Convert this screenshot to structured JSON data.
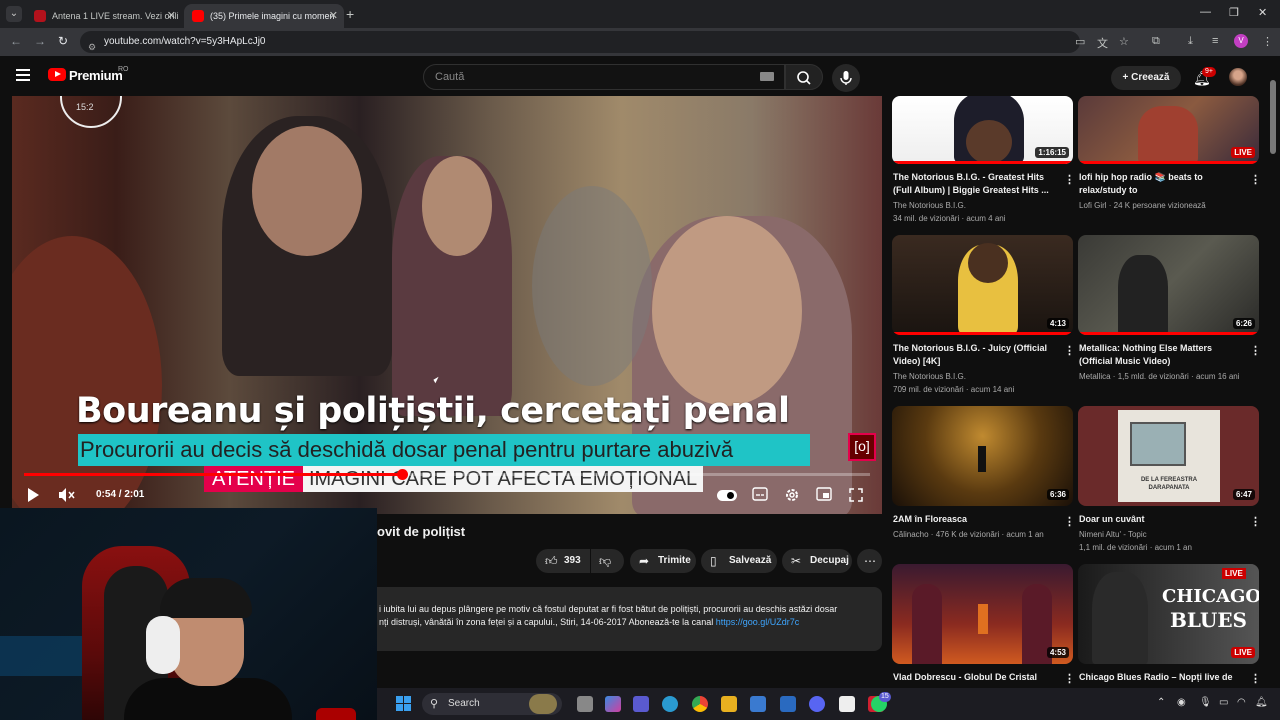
{
  "browser": {
    "tabs": [
      {
        "title": "Antena 1 LIVE stream. Vezi onli",
        "active": false
      },
      {
        "title": "(35) Primele imagini cu momen",
        "active": true
      }
    ],
    "url": "youtube.com/watch?v=5y3HApLcJj0",
    "profile_initial": "V"
  },
  "youtube": {
    "brand": "Premium",
    "country": "RO",
    "search_placeholder": "Caută",
    "create_label": "Creează",
    "notifications": "9+"
  },
  "player": {
    "caption_title": "Boureanu și polițiștii, cercetați penal",
    "caption_sub": "Procurorii au decis să deschidă dosar penal pentru purtare abuzivă",
    "warning_red": "ATENȚIE",
    "warning_white": "IMAGINI CARE POT AFECTA EMOȚIONAL",
    "channel_logo": "[o]",
    "clock_text": "15:2",
    "time_display": "0:54 / 2:01",
    "progress_fraction": 0.447
  },
  "video": {
    "title_fragment": "ovit de polițist",
    "likes": "393",
    "share_label": "Trimite",
    "save_label": "Salvează",
    "clip_label": "Decupaj",
    "description_line1": "i iubita lui au depus plângere pe motiv că fostul deputat ar fi fost bătut de polițiști, procurorii au deschis astăzi dosar",
    "description_line2": "nți distruși, vânătăi în zona feței și a capului., Stiri, 14-06-2017 Abonează-te la canal ",
    "description_link": "https://goo.gl/UZdr7c"
  },
  "sidebar": {
    "videos": [
      {
        "title": "The Notorious B.I.G. - Greatest Hits (Full Album) | Biggie Greatest Hits ...",
        "channel": "The Notorious B.I.G.",
        "meta": "34 mil. de vizionări · acum 4 ani",
        "badge": "1:16:15",
        "live": false
      },
      {
        "title": "lofi hip hop radio 📚 beats to relax/study to",
        "channel": "Lofi Girl",
        "meta": "24 K persoane vizionează",
        "badge": "LIVE",
        "live": true
      },
      {
        "title": "The Notorious B.I.G. - Juicy (Official Video) [4K]",
        "channel": "The Notorious B.I.G.",
        "meta": "709 mil. de vizionări · acum 14 ani",
        "badge": "4:13",
        "live": false
      },
      {
        "title": "Metallica: Nothing Else Matters (Official Music Video)",
        "channel": "Metallica",
        "meta": "1,5 mld. de vizionări · acum 16 ani",
        "badge": "6:26",
        "live": false
      },
      {
        "title": "2AM în Floreasca",
        "channel": "Călinacho",
        "meta": "476 K de vizionări · acum 1 an",
        "badge": "6:36",
        "live": false
      },
      {
        "title": "Doar un cuvânt",
        "channel": "Nimeni Altu' - Topic",
        "meta": "1,1 mil. de vizionări · acum 1 an",
        "badge": "6:47",
        "live": false
      },
      {
        "title": "Vlad Dobrescu - Globul De Cristal (feat.",
        "channel": "",
        "meta": "",
        "badge": "4:53",
        "live": false
      },
      {
        "title": "Chicago Blues Radio – Nopți live de",
        "channel": "",
        "meta": "",
        "badge": "LIVE",
        "live": true
      }
    ],
    "thumb_texts": {
      "fereastra": "DE LA FEREASTRA DARAPANATA",
      "chicago_live": "LIVE",
      "chicago": "CHICAGO",
      "blues": "BLUES"
    }
  },
  "taskbar": {
    "search_label": "Search",
    "teams_badge": "15"
  },
  "colors": {
    "accent_red": "#ff0000",
    "caption_cyan": "#1fc4c6",
    "warning_pink": "#e4004b",
    "link_blue": "#3ea6ff"
  }
}
